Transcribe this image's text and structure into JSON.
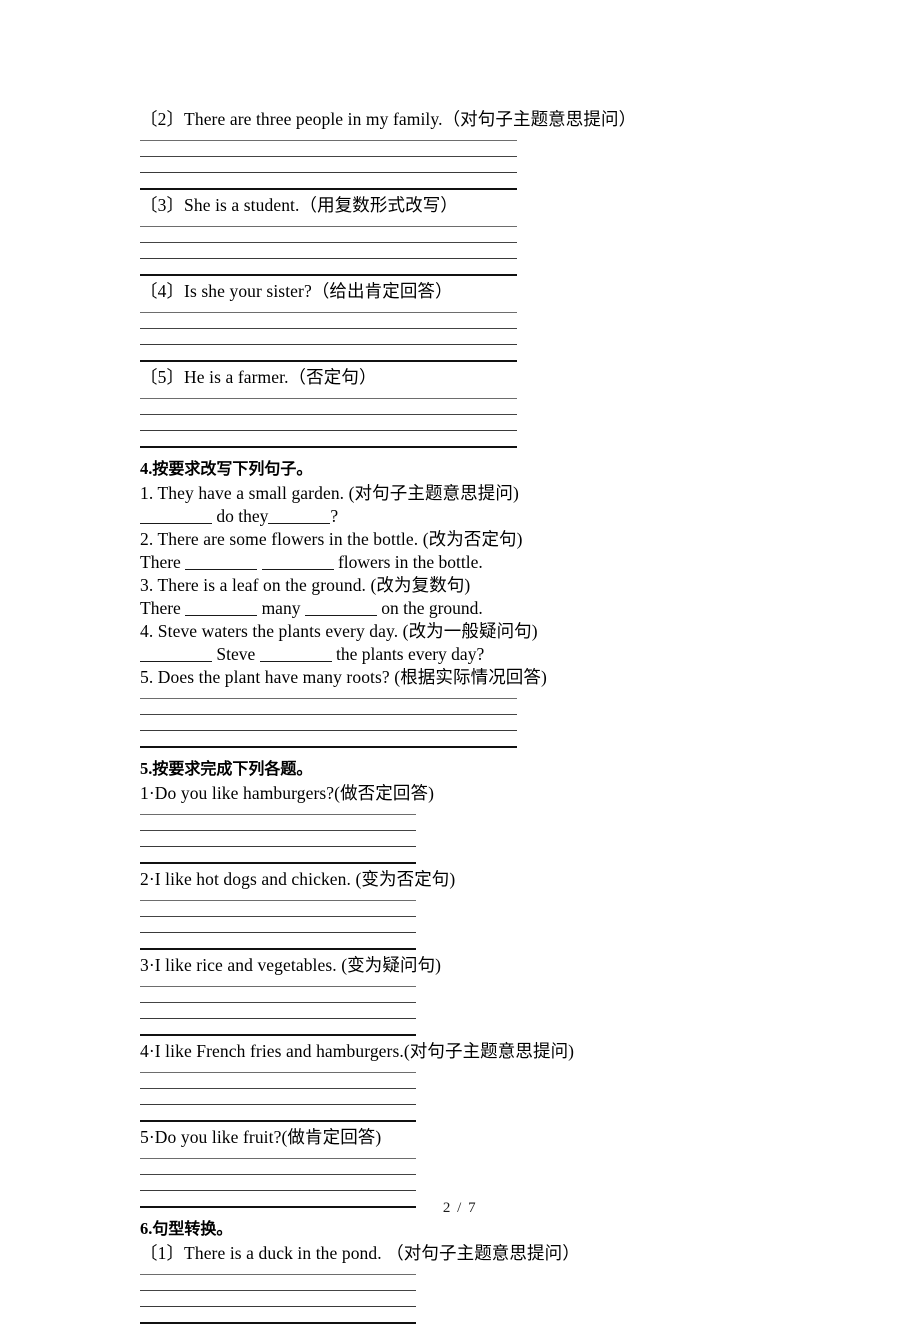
{
  "document": {
    "page_label": "2 / 7"
  },
  "blocks": [
    {
      "kind": "question",
      "text": "〔2〕There are three people in my family.（对句子主题意思提问）"
    },
    {
      "kind": "rules",
      "width": "wide"
    },
    {
      "kind": "question",
      "text": "〔3〕She is a student.（用复数形式改写）"
    },
    {
      "kind": "rules",
      "width": "wide"
    },
    {
      "kind": "question",
      "text": "〔4〕Is she your sister?（给出肯定回答）"
    },
    {
      "kind": "rules",
      "width": "wide"
    },
    {
      "kind": "question",
      "text": "〔5〕He is a farmer.（否定句）"
    },
    {
      "kind": "rules",
      "width": "wide"
    }
  ],
  "section4": {
    "number": "4.",
    "title": "按要求改写下列句子。",
    "items": [
      {
        "prompt": "1. They have a small garden. (对句子主题意思提问)"
      },
      {
        "prompt": "2. There are some flowers in the bottle. (改为否定句)"
      },
      {
        "prompt": "3. There is a leaf on the ground. (改为复数句)"
      },
      {
        "prompt": "4. Steve waters the plants every day. (改为一般疑问句)"
      },
      {
        "prompt": "5. Does the plant have many roots? (根据实际情况回答)"
      }
    ],
    "answers": {
      "a1_mid": " do they",
      "a1_end": "?",
      "a2_pre": "There ",
      "a2_mid": " ",
      "a2_post": " flowers in the bottle.",
      "a3_pre": "There ",
      "a3_mid": " many ",
      "a3_post": " on the ground.",
      "a4_mid": " Steve ",
      "a4_post": " the plants every day?"
    }
  },
  "section5": {
    "number": "5.",
    "title": "按要求完成下列各题。",
    "items": [
      {
        "prompt": "1·Do you like hamburgers?(做否定回答)"
      },
      {
        "prompt": "2·I like hot dogs and chicken. (变为否定句)"
      },
      {
        "prompt": "3·I like rice and vegetables. (变为疑问句)"
      },
      {
        "prompt": "4·I like French fries and hamburgers.(对句子主题意思提问)"
      },
      {
        "prompt": "5·Do you like fruit?(做肯定回答)"
      }
    ]
  },
  "section6": {
    "number": "6.",
    "title": "句型转换。",
    "items": [
      {
        "prompt": "〔1〕There is a duck in the pond. （对句子主题意思提问）"
      }
    ]
  }
}
